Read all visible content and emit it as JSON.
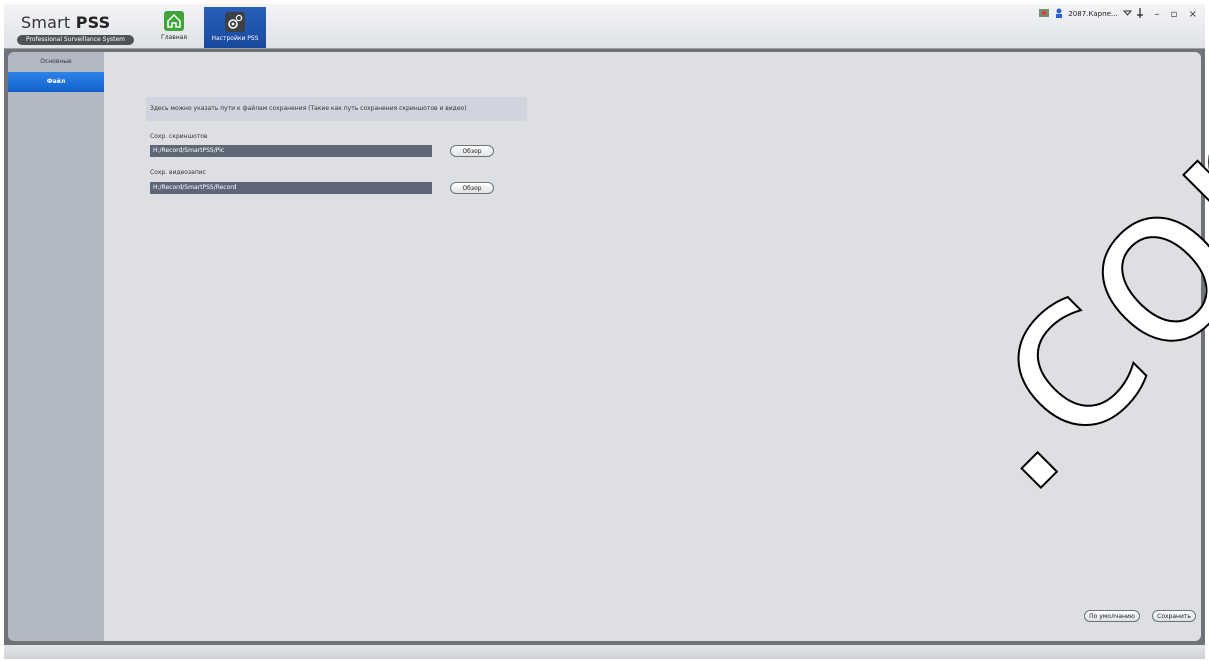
{
  "app": {
    "title_light": "Smart ",
    "title_bold": "PSS",
    "subtitle": "Professional Surveillance System"
  },
  "tabs": [
    {
      "label": "Главная",
      "icon": "home-icon"
    },
    {
      "label": "Настройки PSS",
      "icon": "gear-icon"
    }
  ],
  "tray": {
    "user_text": "2087.Карпе...",
    "minimize": "–",
    "maximize": "▫",
    "close": "×"
  },
  "sidebar": {
    "items": [
      {
        "label": "Основные"
      },
      {
        "label": "Файл"
      }
    ]
  },
  "main": {
    "info_text": "Здесь можно указать пути к файлам сохранения (Такие как путь сохранения скриншотов и видео)",
    "screenshots_label": "Сохр. скриншотов",
    "screenshots_path": "H:/Record/SmartPSS/Pic",
    "video_label": "Сохр. видеозапис",
    "video_path": "H:/Record/SmartPSS/Record",
    "browse_label": "Обзор",
    "default_label": "По умолчанию",
    "save_label": "Сохранить"
  },
  "watermark": ".com"
}
